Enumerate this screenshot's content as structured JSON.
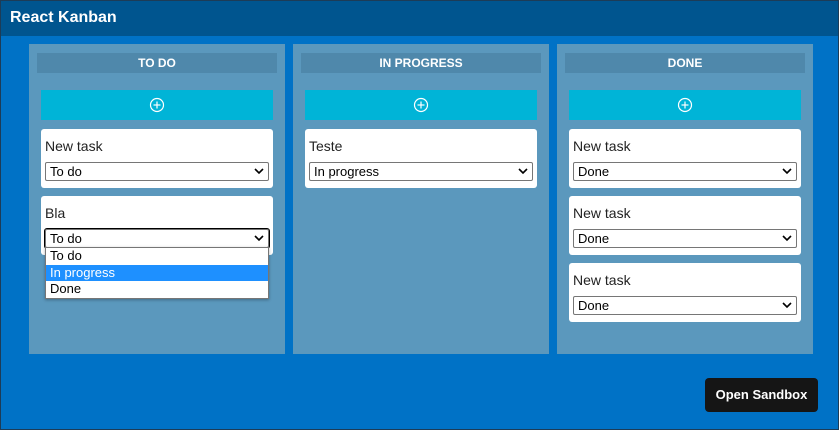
{
  "app": {
    "title": "React Kanban"
  },
  "colors": {
    "background": "#0072c6",
    "topbar": "#00558f",
    "column": "#5b98bd",
    "add_button": "#00b4d7",
    "selected_option": "#1e90ff"
  },
  "columns": [
    {
      "title": "TO DO",
      "add_icon": "plus-circle-icon",
      "cards": [
        {
          "title": "New task",
          "status": "To do"
        },
        {
          "title": "Bla",
          "status": "To do"
        }
      ]
    },
    {
      "title": "IN PROGRESS",
      "add_icon": "plus-circle-icon",
      "cards": [
        {
          "title": "Teste",
          "status": "In progress"
        }
      ]
    },
    {
      "title": "DONE",
      "add_icon": "plus-circle-icon",
      "cards": [
        {
          "title": "New task",
          "status": "Done"
        },
        {
          "title": "New task",
          "status": "Done"
        },
        {
          "title": "New task",
          "status": "Done"
        }
      ]
    }
  ],
  "dropdown": {
    "options": [
      "To do",
      "In progress",
      "Done"
    ],
    "highlighted": "In progress"
  },
  "sandbox_button": {
    "label": "Open Sandbox"
  }
}
